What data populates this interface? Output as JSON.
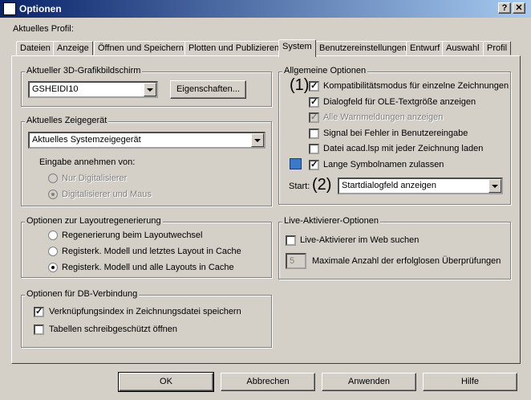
{
  "window": {
    "title": "Optionen",
    "help": "?",
    "close": "✕"
  },
  "profile": {
    "label": "Aktuelles Profil:"
  },
  "tabs": [
    "Dateien",
    "Anzeige",
    "Öffnen und Speichern",
    "Plotten und Publizieren",
    "System",
    "Benutzereinstellungen",
    "Entwurf",
    "Auswahl",
    "Profil"
  ],
  "grafik": {
    "legend": "Aktueller 3D-Grafikbildschirm",
    "value": "GSHEIDI10",
    "button": "Eigenschaften..."
  },
  "zeige": {
    "legend": "Aktuelles Zeigegerät",
    "value": "Aktuelles Systemzeigegerät",
    "input_label": "Eingabe annehmen von:",
    "opt1": "Nur Digitalisierer",
    "opt2": "Digitalisierer und Maus"
  },
  "layout": {
    "legend": "Optionen zur Layoutregenerierung",
    "opt1": "Regenerierung beim Layoutwechsel",
    "opt2": "Registerk. Modell und letztes Layout in Cache",
    "opt3": "Registerk. Modell und alle Layouts in Cache"
  },
  "db": {
    "legend": "Optionen für DB-Verbindung",
    "chk1": "Verknüpfungsindex in Zeichnungsdatei speichern",
    "chk2": "Tabellen schreibgeschützt öffnen"
  },
  "allgemein": {
    "legend": "Allgemeine Optionen",
    "annot1": "(1)",
    "annot2": "(2)",
    "c1": "Kompatibilitätsmodus für einzelne Zeichnungen",
    "c2": "Dialogfeld für OLE-Textgröße anzeigen",
    "c3": "Alle Warnmeldungen anzeigen",
    "c4": "Signal bei Fehler in Benutzereingabe",
    "c5": "Datei acad.lsp mit jeder Zeichnung laden",
    "c6": "Lange Symbolnamen zulassen",
    "start_label": "Start:",
    "start_value": "Startdialogfeld anzeigen"
  },
  "live": {
    "legend": "Live-Aktivierer-Optionen",
    "chk": "Live-Aktivierer im Web suchen",
    "num": "5",
    "num_label": "Maximale Anzahl der erfolglosen Überprüfungen"
  },
  "buttons": {
    "ok": "OK",
    "cancel": "Abbrechen",
    "apply": "Anwenden",
    "help": "Hilfe"
  }
}
